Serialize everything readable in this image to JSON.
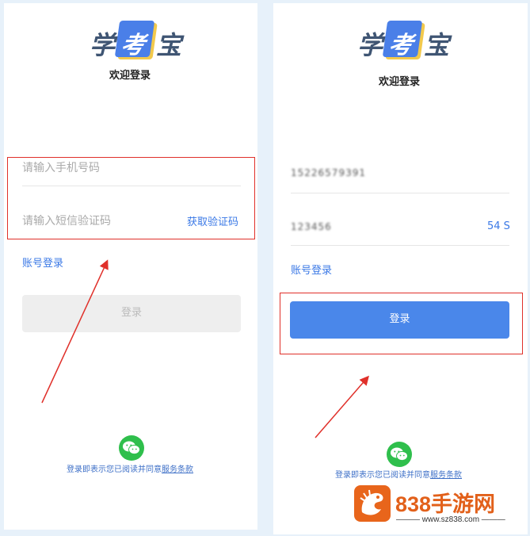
{
  "left": {
    "logo": {
      "c1": "学",
      "c2": "考",
      "c3": "宝"
    },
    "welcome": "欢迎登录",
    "phone_placeholder": "请输入手机号码",
    "code_placeholder": "请输入短信验证码",
    "get_code": "获取验证码",
    "account_login": "账号登录",
    "login_button": "登录",
    "terms_prefix": "登录即表示您已阅读并同意",
    "terms_link": "服务条款"
  },
  "right": {
    "logo": {
      "c1": "学",
      "c2": "考",
      "c3": "宝"
    },
    "welcome": "欢迎登录",
    "phone_value": "15226579391",
    "code_value": "123456",
    "countdown": "54 S",
    "account_login": "账号登录",
    "login_button": "登录",
    "terms_prefix": "登录即表示您已阅读并同意",
    "terms_link": "服务条款"
  },
  "watermark": {
    "brand": "838手游网",
    "url": "www.sz838.com"
  },
  "colors": {
    "accent": "#4a87ea",
    "annotation": "#e0302a",
    "wechat": "#2fbf4c",
    "watermark": "#e2601a"
  },
  "icons": [
    "wechat-icon",
    "arrow-annotation",
    "dragon-logo"
  ]
}
